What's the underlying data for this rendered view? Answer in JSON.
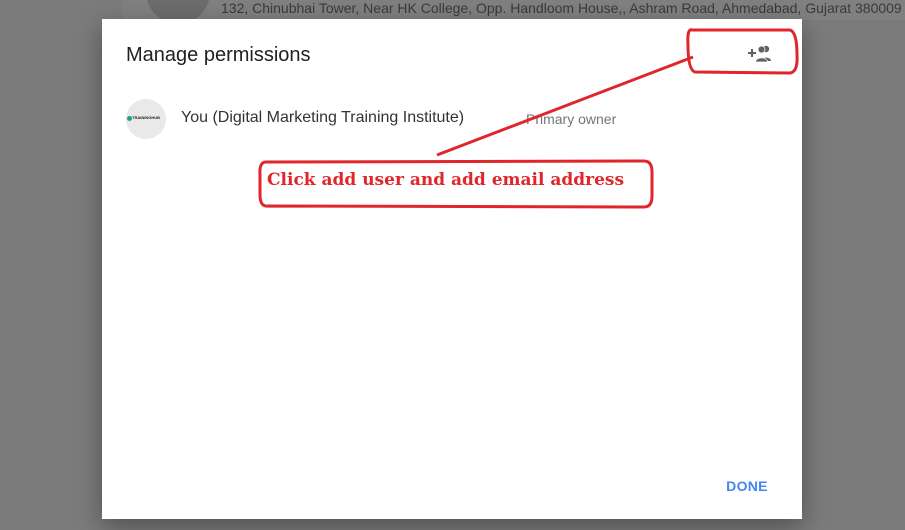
{
  "background": {
    "address": "132, Chinubhai Tower, Near HK College, Opp. Handloom House,, Ashram Road, Ahmedabad, Gujarat 380009"
  },
  "dialog": {
    "title": "Manage permissions",
    "add_user_icon": "person-add-icon",
    "users": [
      {
        "name": "You (Digital Marketing Training Institute)",
        "role": "Primary owner",
        "avatar_logo_text": "TRAININGHUB"
      }
    ],
    "done_label": "DONE"
  },
  "annotation": {
    "text": "Click add user and add email address",
    "color": "#e0262b"
  },
  "colors": {
    "accent": "#4285f4",
    "annotation_red": "#e0262b"
  }
}
